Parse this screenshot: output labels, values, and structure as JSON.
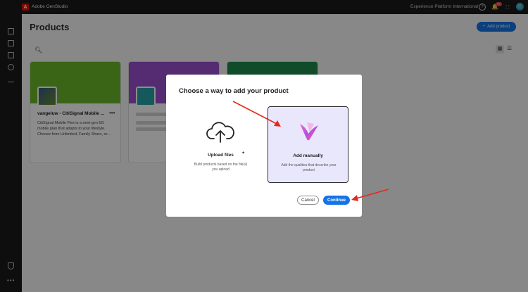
{
  "topbar": {
    "logo_glyph": "A",
    "app_title": "Adobe GenStudio",
    "org_name": "Experience Platform International",
    "notification_count": "9+"
  },
  "sidebar": {
    "icons": [
      "layout-icon",
      "copy-icon",
      "edit-icon",
      "target-icon",
      "chart-icon"
    ],
    "bottom": [
      "shield-icon",
      "more-icon"
    ]
  },
  "main": {
    "page_title": "Products",
    "add_button_label": "Add product",
    "cards": [
      {
        "title": "vangeluw - CitiSignal Mobile ...",
        "description": "CitiSignal Mobile Flex is a next-gen 5G mobile plan that adapts to your lifestyle. Choose from Unlimited, Family Share, or...",
        "banner_color": "#6ab82a",
        "thumb_color": "#3a6a4a"
      },
      {
        "banner_color": "#9b4fcf",
        "thumb_color": "#27a3a8"
      },
      {
        "banner_color": "#1e8a4c",
        "thumb_color": "#2f7f5a"
      }
    ]
  },
  "dialog": {
    "title": "Choose a way to add your product",
    "options": [
      {
        "label": "Upload files",
        "description": "Build products based on the file(s) you upload"
      },
      {
        "label": "Add manually",
        "description": "Add the qualities that describe your product"
      }
    ],
    "cancel_label": "Cancel",
    "continue_label": "Continue"
  },
  "colors": {
    "accent": "#1473e6",
    "annotation_arrow": "#e5281e",
    "selected_option_bg": "#e9e7fb"
  }
}
